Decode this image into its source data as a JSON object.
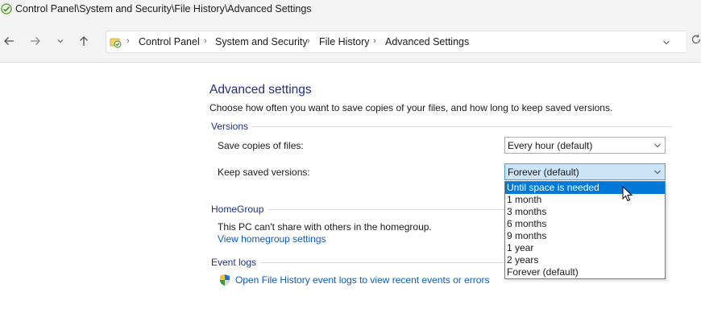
{
  "window": {
    "title": "Control Panel\\System and Security\\File History\\Advanced Settings"
  },
  "nav": {
    "back_icon": "back-arrow-icon",
    "forward_icon": "forward-arrow-icon",
    "recent_icon": "chevron-down-icon",
    "up_icon": "up-arrow-icon",
    "breadcrumbs": [
      "Control Panel",
      "System and Security",
      "File History",
      "Advanced Settings"
    ],
    "refresh_icon": "refresh-icon"
  },
  "page": {
    "heading": "Advanced settings",
    "description": "Choose how often you want to save copies of your files, and how long to keep saved versions.",
    "versions": {
      "group_label": "Versions",
      "save_copies_label": "Save copies of files:",
      "save_copies_value": "Every hour (default)",
      "keep_versions_label": "Keep saved versions:",
      "keep_versions_value": "Forever (default)",
      "keep_versions_options": [
        "Until space is needed",
        "1 month",
        "3 months",
        "6 months",
        "9 months",
        "1 year",
        "2 years",
        "Forever (default)"
      ],
      "highlighted_option": "Until space is needed"
    },
    "homegroup": {
      "group_label": "HomeGroup",
      "status": "This PC can't share with others in the homegroup.",
      "settings_link": "View homegroup settings"
    },
    "event_logs": {
      "group_label": "Event logs",
      "link": "Open File History event logs to view recent events or errors"
    }
  },
  "colors": {
    "heading": "#1e3287",
    "link": "#0a5bc4",
    "selection": "#0078d7"
  }
}
